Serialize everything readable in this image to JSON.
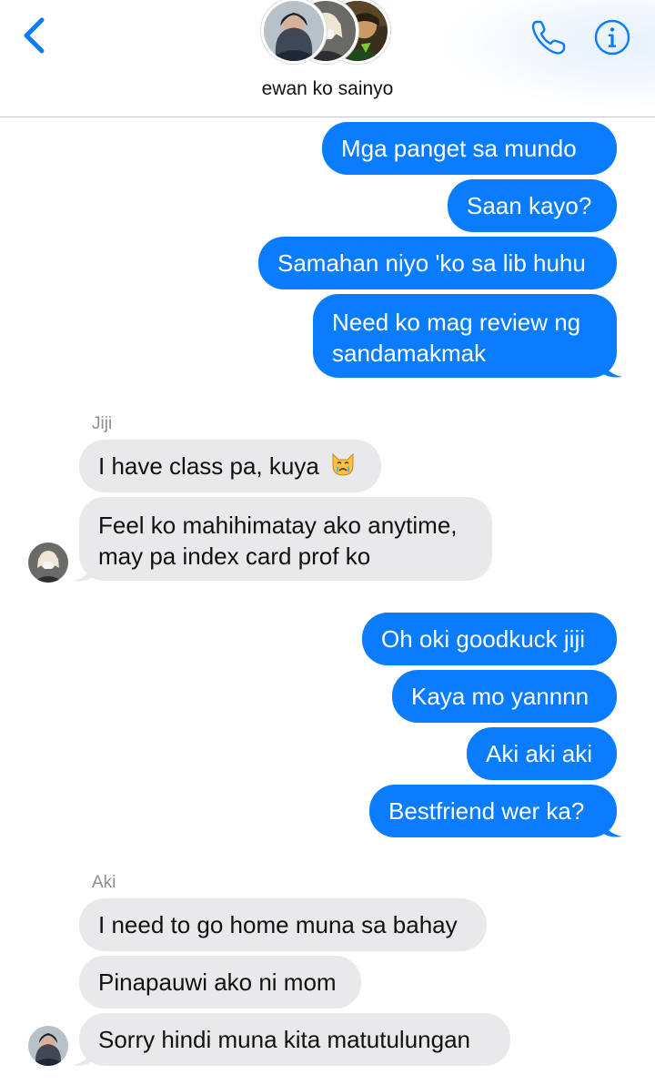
{
  "header": {
    "group_name": "ewan ko sainyo",
    "back_icon": "chevron-left-icon",
    "call_icon": "phone-icon",
    "info_icon": "info-icon",
    "accent_color": "#0a7cff"
  },
  "messages": [
    {
      "from": "me",
      "text": "Mga panget sa mundo"
    },
    {
      "from": "me",
      "text": "Saan kayo?"
    },
    {
      "from": "me",
      "text": "Samahan niyo 'ko sa lib huhu"
    },
    {
      "from": "me",
      "lines": [
        "Need ko mag review ng",
        "sandamakmak"
      ]
    },
    {
      "from": "Jiji",
      "sender_label": "Jiji"
    },
    {
      "from": "Jiji",
      "text": "I have class pa, kuya",
      "emoji": "crying-cat-icon"
    },
    {
      "from": "Jiji",
      "lines": [
        "Feel ko mahihimatay ako anytime,",
        "may pa index card prof ko"
      ]
    },
    {
      "from": "me",
      "text": "Oh oki goodkuck jiji"
    },
    {
      "from": "me",
      "text": "Kaya mo yannnn"
    },
    {
      "from": "me",
      "text": "Aki aki aki"
    },
    {
      "from": "me",
      "text": "Bestfriend wer ka?"
    },
    {
      "from": "Aki",
      "sender_label": "Aki"
    },
    {
      "from": "Aki",
      "text": "I need to go home muna sa bahay"
    },
    {
      "from": "Aki",
      "text": "Pinapauwi ako ni mom"
    },
    {
      "from": "Aki",
      "text": "Sorry hindi muna kita matutulungan"
    }
  ],
  "colors": {
    "outgoing_bubble": "#0a7cff",
    "incoming_bubble": "#e9e9eb",
    "sender_label": "#8e8e93"
  }
}
